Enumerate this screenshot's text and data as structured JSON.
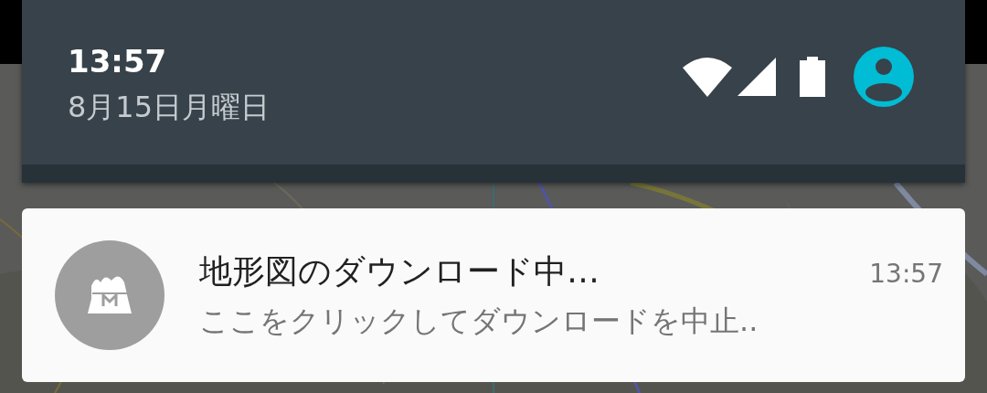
{
  "header": {
    "time": "13:57",
    "date": "8月15日月曜日"
  },
  "notification": {
    "title": "地形図のダウンロード中…",
    "time": "13:57",
    "text": "ここをクリックしてダウンロードを中止.."
  }
}
